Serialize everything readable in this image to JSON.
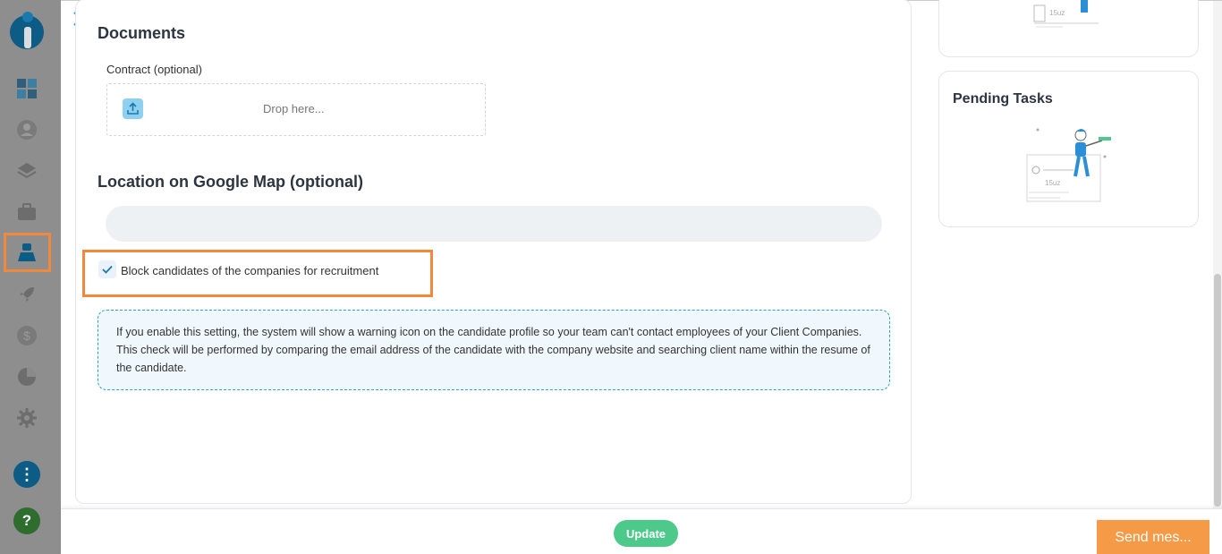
{
  "sidebar": {
    "items": [
      "dashboard-icon",
      "contacts-icon",
      "layers-icon",
      "briefcase-icon",
      "candidates-icon",
      "rocket-icon",
      "dollar-icon",
      "pie-chart-icon",
      "gear-icon"
    ],
    "active_item": "candidates-icon",
    "more_icon": "⋮",
    "help_icon": "?"
  },
  "documents": {
    "title": "Documents",
    "contract_label": "Contract (optional)",
    "dropzone_text": "Drop here..."
  },
  "location": {
    "title": "Location on Google Map (optional)",
    "input_value": ""
  },
  "block_candidates": {
    "label": "Block candidates of the companies for recruitment",
    "checked": true
  },
  "info": {
    "text": "If you enable this setting, the system will show a warning icon on the candidate profile so your team can't contact employees of your Client Companies. This check will be performed by comparing the email address of the candidate with the company website and searching client name within the resume of the candidate."
  },
  "side": {
    "pending_tasks_title": "Pending Tasks"
  },
  "footer": {
    "update_label": "Update",
    "send_label": "Send mes..."
  },
  "colors": {
    "highlight": "#f0883e",
    "update": "#4cc98b",
    "send": "#f59a46",
    "info_border": "#27a6c9",
    "accent": "#1a9ad6"
  }
}
